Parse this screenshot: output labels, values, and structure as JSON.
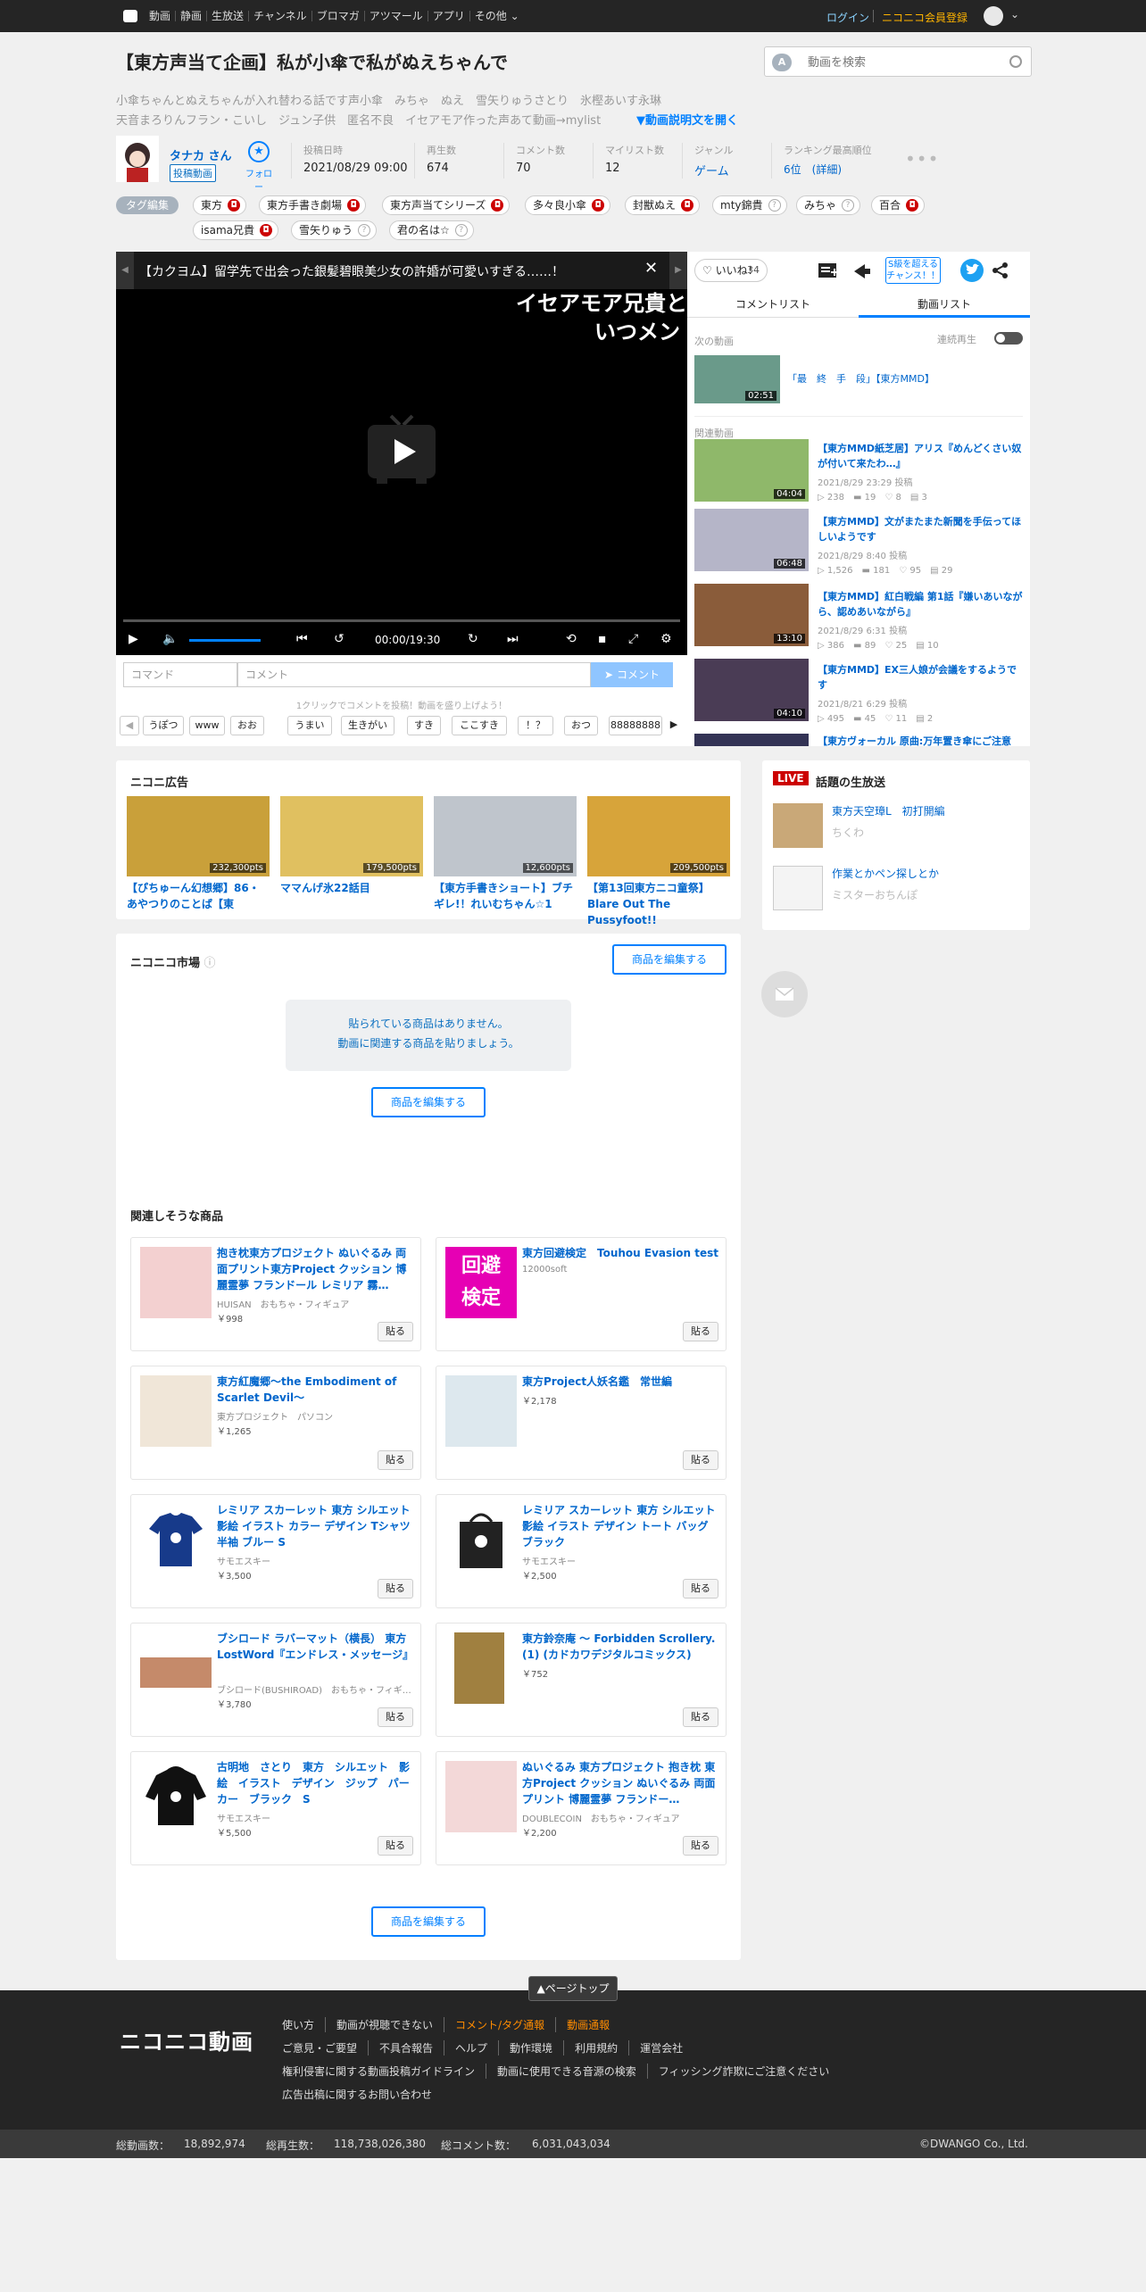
{
  "topbar": {
    "nav": [
      "動画",
      "静画",
      "生放送",
      "チャンネル",
      "ブロマガ",
      "アツマール",
      "アプリ",
      "その他"
    ],
    "login": "ログイン",
    "register": "ニコニコ会員登録"
  },
  "header": {
    "title": "【東方声当て企画】私が小傘で私がぬえちゃんで",
    "search_placeholder": "動画を検索",
    "desc_line1": "小傘ちゃんとぬえちゃんが入れ替わる話です声小傘　みちゃ　ぬえ　雪矢りゅうさとり　氷樫あいす永琳",
    "desc_line2": "天音まろりんフラン・こいし　ジュン子供　匿名不良　イセアモア作った声あて動画→mylist",
    "desc_toggle": "▼動画説明文を開く"
  },
  "owner": {
    "name": "タナカ さん",
    "badge": "投稿動画",
    "follow": "フォロー"
  },
  "meta": [
    {
      "label": "投稿日時",
      "value": "2021/08/29 09:00"
    },
    {
      "label": "再生数",
      "value": "674"
    },
    {
      "label": "コメント数",
      "value": "70"
    },
    {
      "label": "マイリスト数",
      "value": "12"
    },
    {
      "label": "ジャンル",
      "value": "ゲーム"
    },
    {
      "label": "ランキング最高順位",
      "value": "6位　(詳細)"
    }
  ],
  "tags": {
    "edit": "タグ編集",
    "row1": [
      {
        "t": "東方",
        "lock": true
      },
      {
        "t": "東方手書き劇場",
        "lock": true
      },
      {
        "t": "東方声当てシリーズ",
        "lock": true
      },
      {
        "t": "多々良小傘",
        "lock": true
      },
      {
        "t": "封獣ぬえ",
        "lock": true
      },
      {
        "t": "mty錦貴",
        "lock": false
      },
      {
        "t": "みちゃ",
        "lock": false
      },
      {
        "t": "百合",
        "lock": true
      }
    ],
    "row2": [
      {
        "t": "isama兄貴",
        "lock": true
      },
      {
        "t": "雪矢りゅう",
        "lock": false
      },
      {
        "t": "君の名は☆",
        "lock": false
      }
    ]
  },
  "player": {
    "banner": "【カクヨム】留学先で出会った銀髪碧眼美少女の許婚が可愛いすぎる……！",
    "comment_line1": "イセアモア兄貴と",
    "comment_line2": "いつメン",
    "time": "00:00/19:30",
    "command_placeholder": "コマンド",
    "comment_placeholder": "コメント",
    "comment_button": "コメント",
    "hint": "1クリックでコメントを投稿！動画を盛り上げよう！",
    "chips": [
      "うぽつ",
      "www",
      "おお",
      "うまい",
      "生きがい",
      "すき",
      "ここすき",
      "！？",
      "おつ",
      "88888888"
    ]
  },
  "right": {
    "like": "いいね！",
    "like_count": "34",
    "sfive": "S級を超える\nチャンス！！",
    "tabs": [
      "コメントリスト",
      "動画リスト"
    ],
    "next_label": "次の動画",
    "autoplay": "連続再生",
    "next_title": "「最　終　手　段」【東方MMD】",
    "next_dur": "02:51",
    "related_label": "関連動画",
    "related": [
      {
        "title": "【東方MMD紙芝居】アリス『めんどくさい奴が付いて来たわ…』",
        "date": "2021/8/29 23:29 投稿",
        "stats": [
          "238",
          "19",
          "8",
          "3"
        ],
        "dur": "04:04",
        "color": "#8fb86a"
      },
      {
        "title": "【東方MMD】文がまたまた新聞を手伝ってほしいようです",
        "date": "2021/8/29 8:40 投稿",
        "stats": [
          "1,526",
          "181",
          "95",
          "29"
        ],
        "dur": "06:48",
        "color": "#b5b5c8"
      },
      {
        "title": "【東方MMD】紅白戦編 第1話『嫌いあいながら、認めあいながら』",
        "date": "2021/8/29 6:31 投稿",
        "stats": [
          "386",
          "89",
          "25",
          "10"
        ],
        "dur": "13:10",
        "color": "#8a5c3a"
      },
      {
        "title": "【東方MMD】EX三人娘が会議をするようです",
        "date": "2021/8/21 6:29 投稿",
        "stats": [
          "495",
          "45",
          "11",
          "2"
        ],
        "dur": "04:10",
        "color": "#4a3c55"
      },
      {
        "title": "【東方ヴォーカル 原曲:万年置き傘にご注意を】",
        "date": "",
        "stats": [],
        "dur": "",
        "color": "#335"
      }
    ]
  },
  "ads": {
    "title": "ニコニ広告",
    "items": [
      {
        "pts": "232,300pts",
        "title": "【ぴちゅーん幻想郷】86・あやつりのことば【東",
        "color": "#c9a03a"
      },
      {
        "pts": "179,500pts",
        "title": "ママんげ氷22話目",
        "color": "#e0c060"
      },
      {
        "pts": "12,600pts",
        "title": "【東方手書きショート】ブチギレ!！れいむちゃん☆1",
        "color": "#bfc5cc"
      },
      {
        "pts": "209,500pts",
        "title": "【第13回東方ニコ童祭】Blare Out The Pussyfoot!!",
        "color": "#d7a43a"
      }
    ]
  },
  "live": {
    "badge": "LIVE",
    "title": "話題の生放送",
    "items": [
      {
        "title": "東方天空璋L　初打開編",
        "user": "ちくわ"
      },
      {
        "title": "作業とかペン探しとか",
        "user": "ミスターおちんぽ"
      }
    ]
  },
  "market": {
    "title": "ニコニコ市場",
    "edit": "商品を編集する",
    "empty_line1": "貼られている商品はありません。",
    "empty_line2": "動画に関連する商品を貼りましょう。",
    "related_title": "関連しそうな商品",
    "paste": "貼る",
    "products": [
      {
        "title": "抱き枕東方プロジェクト ぬいぐるみ 両面プリント東方Project クッション 博麗霊夢 フランドール レミリア 霧…",
        "sub": "HUISAN　おもちゃ・フィギュア",
        "price": "￥998",
        "color": "#f3d0d0"
      },
      {
        "title": "東方回避検定　Touhou Evasion test",
        "sub": "12000soft",
        "price": "",
        "color": "#e600b4"
      },
      {
        "title": "東方紅魔郷～the Embodiment of Scarlet Devil～",
        "sub": "東方プロジェクト　パソコン",
        "price": "￥1,265",
        "color": "#f0e6d8"
      },
      {
        "title": "東方Project人妖名鑑　常世編",
        "sub": "",
        "price": "￥2,178",
        "color": "#dde8ee"
      },
      {
        "title": "レミリア スカーレット 東方 シルエット 影絵 イラスト カラー デザイン Tシャツ 半袖 ブルー S",
        "sub": "サモエスキー",
        "price": "￥3,500",
        "color": "#173a8a"
      },
      {
        "title": "レミリア スカーレット 東方 シルエット 影絵 イラスト デザイン トート バッグ ブラック",
        "sub": "サモエスキー",
        "price": "￥2,500",
        "color": "#222"
      },
      {
        "title": "ブシロード ラバーマット（横長） 東方LostWord『エンドレス・メッセージ』",
        "sub": "ブシロード(BUSHIROAD)　おもちゃ・フィギ…",
        "price": "￥3,780",
        "color": "#c58a6a"
      },
      {
        "title": "東方鈴奈庵 ～ Forbidden Scrollery. (1) (カドカワデジタルコミックス)",
        "sub": "",
        "price": "￥752",
        "color": "#a08040"
      },
      {
        "title": "古明地　さとり　東方　シルエット　影絵　イラスト　デザイン　ジップ　パーカー　ブラック　S",
        "sub": "サモエスキー",
        "price": "￥5,500",
        "color": "#111"
      },
      {
        "title": "ぬいぐるみ 東方プロジェクト 抱き枕 東方Project クッション ぬいぐるみ 両面プリント 博麗霊夢 フランドー…",
        "sub": "DOUBLECOIN　おもちゃ・フィギュア",
        "price": "￥2,200",
        "color": "#f3d8d8"
      }
    ]
  },
  "footer": {
    "pagetop": "▲ページトップ",
    "logo": "ニコニコ動画",
    "row1": [
      "使い方",
      "動画が視聴できない",
      "コメント/タグ通報",
      "動画通報"
    ],
    "row2": [
      "ご意見・ご要望",
      "不具合報告",
      "ヘルプ",
      "動作環境",
      "利用規約",
      "運営会社"
    ],
    "row3": [
      "権利侵害に関する動画投稿ガイドライン",
      "動画に使用できる音源の検索",
      "フィッシング詐欺にご注意ください"
    ],
    "row4": [
      "広告出稿に関するお問い合わせ"
    ]
  },
  "stats": {
    "videos_label": "総動画数：",
    "videos": "18,892,974",
    "plays_label": "総再生数：",
    "plays": "118,738,026,380",
    "comments_label": "総コメント数：",
    "comments": "6,031,043,034",
    "copyright": "©DWANGO Co., Ltd."
  },
  "colors": {
    "accent": "#0080ff",
    "link": "#0066cc",
    "orange": "#ff8c00",
    "live": "#cc0000"
  }
}
